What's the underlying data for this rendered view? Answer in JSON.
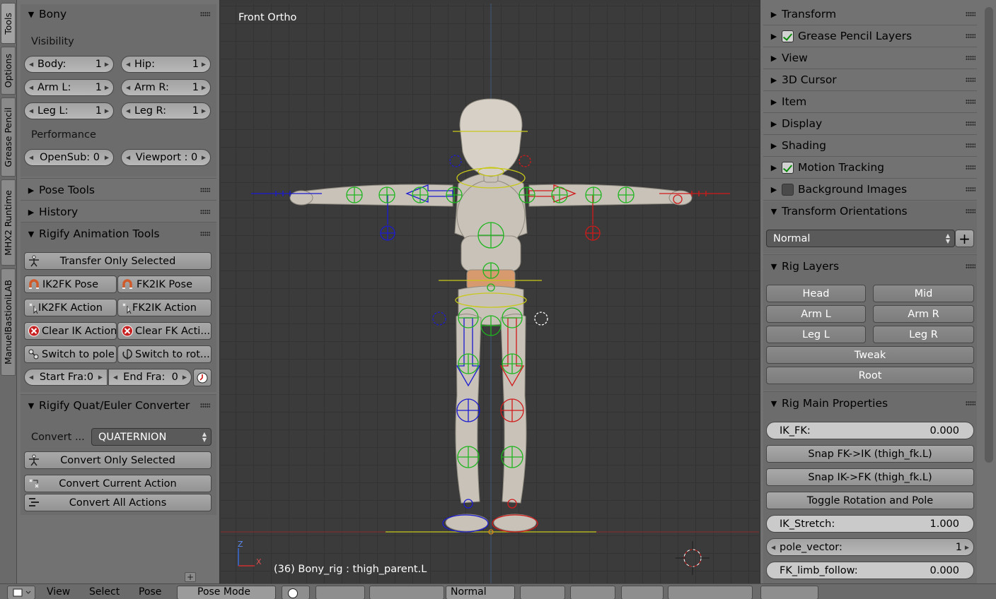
{
  "sidebar_tabs": [
    "Tools",
    "Options",
    "Grease Pencil",
    "MHX2 Runtime",
    "ManuelBastioniLAB"
  ],
  "left": {
    "bony": {
      "title": "Bony",
      "visibility_label": "Visibility",
      "performance_label": "Performance",
      "fields": [
        {
          "name": "Body:",
          "value": "1"
        },
        {
          "name": "Hip:",
          "value": "1"
        },
        {
          "name": "Arm L:",
          "value": "1"
        },
        {
          "name": "Arm R:",
          "value": "1"
        },
        {
          "name": "Leg L:",
          "value": "1"
        },
        {
          "name": "Leg R:",
          "value": "1"
        },
        {
          "name": "OpenSub: 0",
          "value": ""
        },
        {
          "name": "Viewport : 0",
          "value": ""
        }
      ]
    },
    "pose_tools": "Pose Tools",
    "history": "History",
    "rigify_anim": {
      "title": "Rigify Animation Tools",
      "transfer": "Transfer Only Selected",
      "ik2fk_pose": "IK2FK Pose",
      "fk2ik_pose": "FK2IK Pose",
      "ik2fk_action": "IK2FK Action",
      "fk2ik_action": "FK2IK Action",
      "clear_ik": "Clear IK Action",
      "clear_fk": "Clear FK Acti...",
      "switch_pole": "Switch to pole",
      "switch_rot": "Switch to rot...",
      "start_frame": "Start Fra:0",
      "end_frame": "End Fra:",
      "end_value": "0"
    },
    "quat": {
      "title": "Rigify Quat/Euler Converter",
      "convert_label": "Convert ...",
      "mode": "QUATERNION",
      "convert_selected": "Convert Only Selected",
      "convert_current": "Convert Current Action",
      "convert_all": "Convert All Actions"
    }
  },
  "viewport": {
    "title": "Front Ortho",
    "footer": "(36) Bony_rig : thigh_parent.L",
    "axis_z": "Z",
    "axis_x": "X"
  },
  "right": {
    "panels": [
      "Transform",
      "Grease Pencil Layers",
      "View",
      "3D Cursor",
      "Item",
      "Display",
      "Shading",
      "Motion Tracking",
      "Background Images"
    ],
    "transform_orientations": {
      "title": "Transform Orientations",
      "value": "Normal"
    },
    "rig_layers": {
      "title": "Rig Layers",
      "head": "Head",
      "mid": "Mid",
      "arm_l": "Arm L",
      "arm_r": "Arm R",
      "leg_l": "Leg L",
      "leg_r": "Leg R",
      "tweak": "Tweak",
      "root": "Root"
    },
    "rig_main": {
      "title": "Rig Main Properties",
      "ik_fk_label": "IK_FK:",
      "ik_fk_value": "0.000",
      "snap_fk_ik": "Snap FK->IK (thigh_fk.L)",
      "snap_ik_fk": "Snap IK->FK (thigh_fk.L)",
      "toggle": "Toggle Rotation and Pole",
      "ik_stretch_label": "IK_Stretch:",
      "ik_stretch_value": "1.000",
      "pole_label": "pole_vector:",
      "pole_value": "1",
      "fk_follow_label": "FK_limb_follow:",
      "fk_follow_value": "0.000"
    }
  },
  "bottom": {
    "view": "View",
    "select": "Select",
    "pose": "Pose",
    "mode": "Pose Mode",
    "orientation": "Normal"
  },
  "colors": {
    "panel": "#727272",
    "viewport": "#3b3b3b",
    "left_rig": "#1a1ad0",
    "right_rig": "#d01a1a",
    "center_rig": "#1fb51f",
    "root_line": "#c8c81a"
  }
}
